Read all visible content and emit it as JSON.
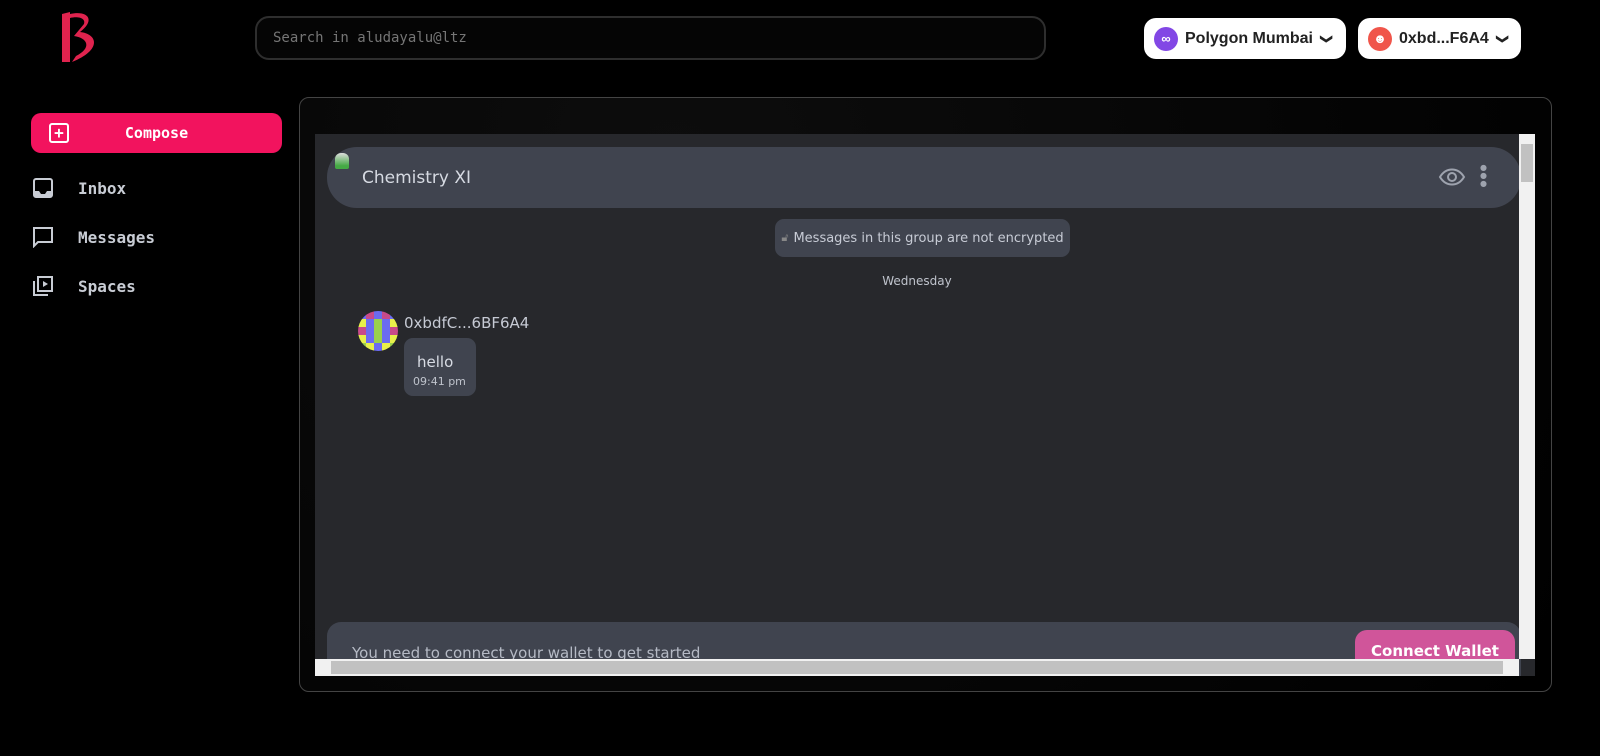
{
  "brand": {
    "color": "#e0234e"
  },
  "search": {
    "placeholder": "Search in aludayalu@ltz"
  },
  "network": {
    "label": "Polygon Mumbai",
    "icon": "polygon-icon",
    "color": "#8247e5"
  },
  "account": {
    "label": "0xbd...F6A4",
    "icon": "avatar-icon",
    "color": "#f0554a"
  },
  "sidebar": {
    "compose": "Compose",
    "accent": "#f2135e",
    "items": [
      {
        "label": "Inbox",
        "icon": "inbox-icon"
      },
      {
        "label": "Messages",
        "icon": "chat-icon"
      },
      {
        "label": "Spaces",
        "icon": "video-library-icon"
      }
    ]
  },
  "chat": {
    "title": "Chemistry XI",
    "notice": "Messages in this group are not encrypted",
    "day": "Wednesday",
    "messages": [
      {
        "sender": "0xbdfC...6BF6A4",
        "text": "hello",
        "time": "09:41 pm"
      }
    ],
    "footer": {
      "text": "You need to connect your wallet to get started",
      "button": "Connect Wallet",
      "button_color": "#d0559a"
    }
  }
}
